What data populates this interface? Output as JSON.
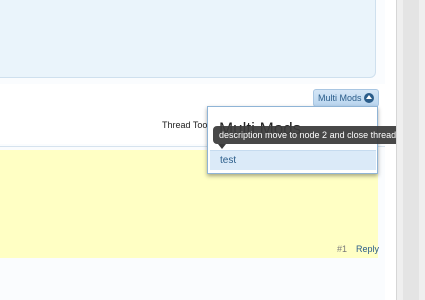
{
  "toolbar": {
    "multi_mods_label": "Multi Mods",
    "thread_tools_label": "Thread Too"
  },
  "multi_mods_menu": {
    "title": "Multi Mods",
    "items": [
      {
        "label": "test",
        "description": "description move to node 2 and close thread"
      }
    ]
  },
  "post": {
    "number": "#1",
    "reply_label": "Reply"
  },
  "icons": {
    "menu_toggle": "chevron-up-icon"
  },
  "colors": {
    "accent": "#2b5d8a",
    "post_background": "#ffffc4",
    "panel_background": "#eaf4fb",
    "tooltip_background": "#3b3b3b"
  }
}
